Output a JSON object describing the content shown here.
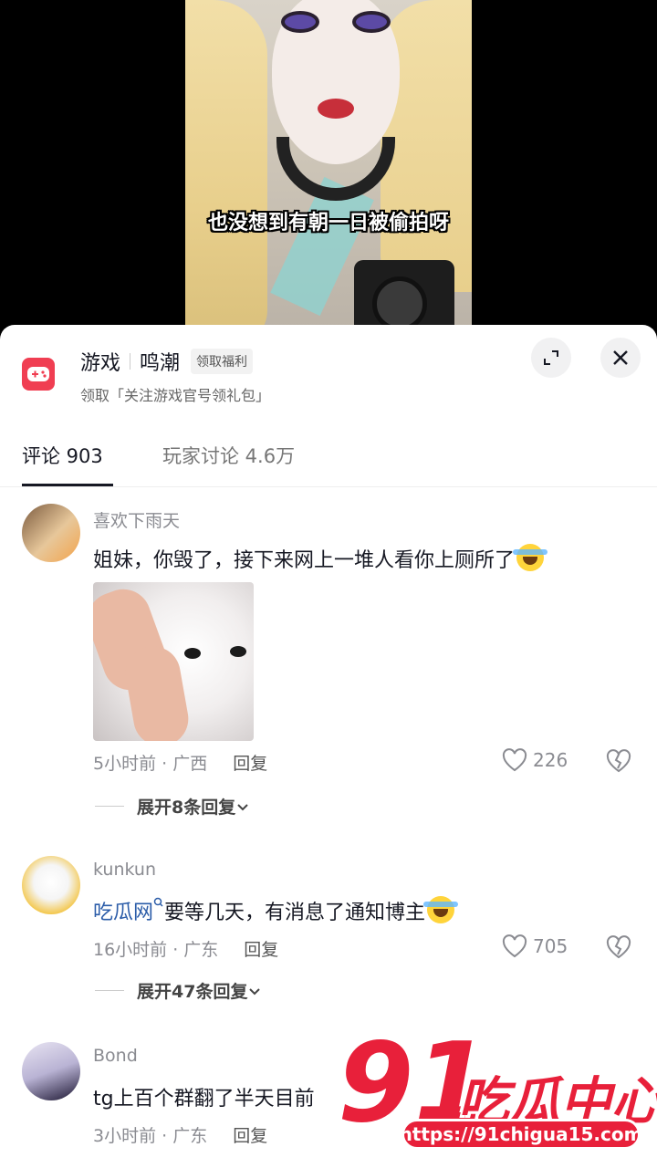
{
  "video": {
    "subtitle": "也没想到有朝一日被偷拍呀"
  },
  "header": {
    "app_name": "游戏",
    "game_name": "鸣潮",
    "tag": "领取福利",
    "subtitle": "领取「关注游戏官号领礼包」",
    "accent": "#f03e52"
  },
  "tabs": [
    {
      "label": "评论 903"
    },
    {
      "label": "玩家讨论 4.6万"
    }
  ],
  "comments": [
    {
      "username": "喜欢下雨天",
      "text": "姐妹，你毁了，接下来网上一堆人看你上厕所了",
      "emoji": "crying-laughing-emoji",
      "meta": "5小时前 · 广西",
      "reply": "回复",
      "likes": "226",
      "expand": "展开8条回复"
    },
    {
      "username": "kunkun",
      "link": "吃瓜网",
      "text": "要等几天，有消息了通知博主",
      "emoji": "crying-laughing-emoji",
      "meta": "16小时前 · 广东",
      "reply": "回复",
      "likes": "705",
      "expand": "展开47条回复"
    },
    {
      "username": "Bond",
      "text": "tg上百个群翻了半天目前",
      "meta": "3小时前 · 广东",
      "reply": "回复"
    }
  ],
  "watermark": {
    "number": "91",
    "brand": "吃瓜中心",
    "url": "https://91chigua15.com"
  }
}
